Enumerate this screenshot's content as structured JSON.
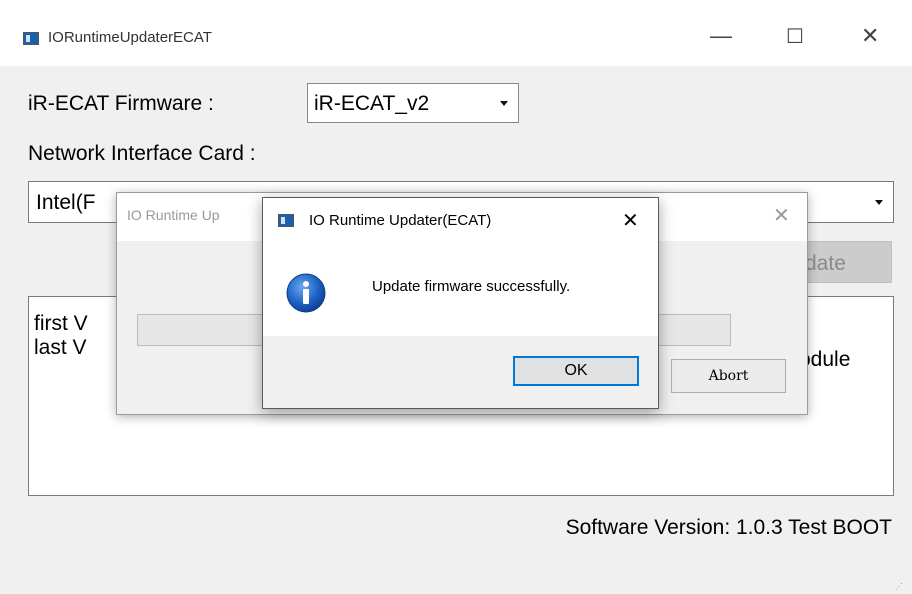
{
  "window": {
    "title": "IORuntimeUpdaterECAT",
    "minimize": "—",
    "maximize": "☐",
    "close": "✕"
  },
  "main": {
    "firmware_label": "iR-ECAT Firmware :",
    "firmware_value": "iR-ECAT_v2",
    "nic_label": "Network Interface Card :",
    "nic_value_visible": "Intel(F",
    "update_button_visible": "date",
    "log_line1_visible": "first V",
    "log_line2_visible": "last V",
    "log_right_visible": "odule",
    "software_version": "Software Version: 1.0.3 Test BOOT"
  },
  "progress_dialog": {
    "title_visible": "IO Runtime Up",
    "close": "✕",
    "abort_label": "Abort"
  },
  "message_dialog": {
    "title": "IO Runtime Updater(ECAT)",
    "close": "✕",
    "message": "Update firmware successfully.",
    "ok_label": "OK",
    "icon": "info-icon"
  },
  "colors": {
    "accent": "#0078d7",
    "info_icon": "#1d63c4"
  }
}
